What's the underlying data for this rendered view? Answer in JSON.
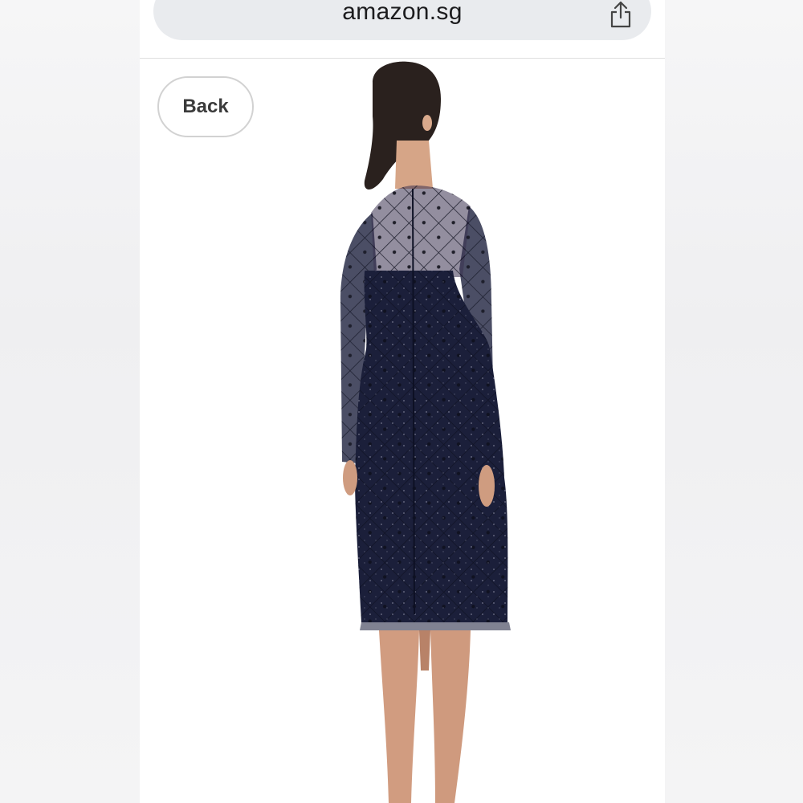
{
  "browser": {
    "url": "amazon.sg",
    "share_icon": "share-icon"
  },
  "page": {
    "back_label": "Back",
    "product_image": {
      "icon": "product-photo",
      "colors": {
        "dress": "#1b1f3a",
        "skin": "#d9a98c",
        "hair": "#2a211e"
      }
    }
  }
}
